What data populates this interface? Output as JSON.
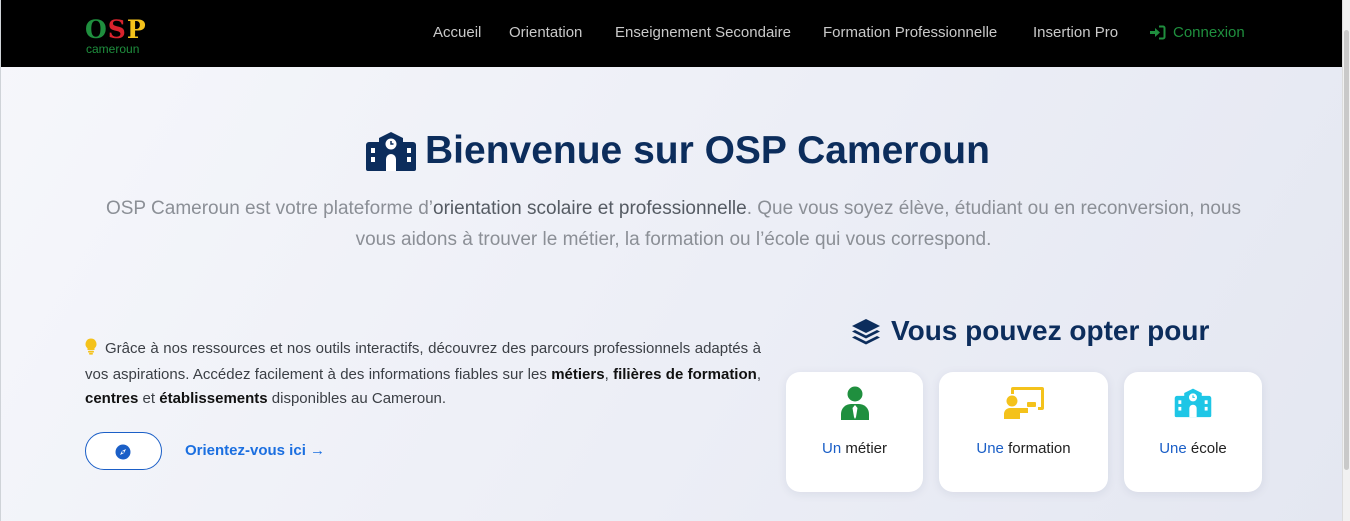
{
  "brand": {
    "logo_o": "O",
    "logo_s": "S",
    "logo_p": "P",
    "subtitle": "cameroun"
  },
  "nav": {
    "items": [
      "Accueil",
      "Orientation",
      "Enseignement Secondaire",
      "Formation Professionnelle",
      "Insertion Pro"
    ],
    "login": "Connexion"
  },
  "hero": {
    "title": "Bienvenue sur OSP Cameroun",
    "desc_before": "OSP Cameroun est votre plateforme d’",
    "desc_strong": "orientation scolaire et professionnelle",
    "desc_after": ". Que vous soyez élève, étudiant ou en reconversion, nous vous aidons à trouver le métier, la formation ou l’école qui vous correspond."
  },
  "intro": {
    "text1": "Grâce à nos ressources et nos outils interactifs, découvrez des parcours professionnels adaptés à vos aspirations. Accédez facilement à des informations fiables sur les ",
    "b1": "métiers",
    "sep1": ", ",
    "b2": "filières de formation",
    "sep2": ", ",
    "b3": "centres",
    "sep3": " et ",
    "b4": "établissements",
    "text2": " disponibles au Cameroun."
  },
  "cta": {
    "link": "Orientez-vous ici →"
  },
  "options": {
    "title": "Vous pouvez opter pour",
    "cards": [
      {
        "prefix": "Un",
        "word": " métier",
        "icon": "user-tie-icon"
      },
      {
        "prefix": "Une",
        "word": " formation",
        "icon": "chalkboard-teacher-icon"
      },
      {
        "prefix": "Une",
        "word": " école",
        "icon": "school-icon"
      }
    ]
  },
  "colors": {
    "navbar": "#000000",
    "title": "#0c2d5c",
    "link": "#1b6fe0",
    "green": "#1f8f3e",
    "red": "#d9232d",
    "yellow": "#f4c21b",
    "cyan": "#1ec6e6"
  }
}
